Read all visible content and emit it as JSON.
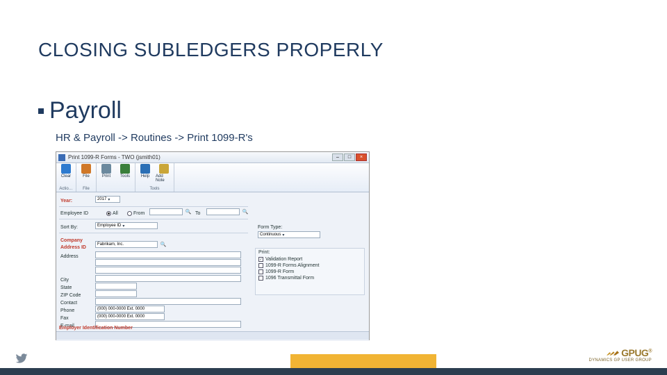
{
  "title": "CLOSING SUBLEDGERS PROPERLY",
  "section": "Payroll",
  "breadcrumb": "HR & Payroll -> Routines -> Print 1099-R's",
  "window": {
    "title": "Print 1099-R Forms - TWO (jsmith01)",
    "ribbon": {
      "groups": [
        {
          "foot": "Actio…",
          "items": [
            {
              "name": "clear-icon",
              "label": "Clear",
              "color": "#2e7bcf"
            }
          ]
        },
        {
          "foot": "File",
          "items": [
            {
              "name": "file-icon",
              "label": "File",
              "color": "#d07828"
            }
          ]
        },
        {
          "foot": "",
          "items": [
            {
              "name": "print-icon",
              "label": "Print",
              "color": "#6b899e"
            },
            {
              "name": "tools-icon",
              "label": "Tools",
              "color": "#3a7f3a"
            }
          ]
        },
        {
          "foot": "Tools",
          "items": [
            {
              "name": "help-icon",
              "label": "Help",
              "color": "#2b6fb5"
            },
            {
              "name": "addnote-icon",
              "label": "Add Note",
              "color": "#caa638"
            }
          ]
        }
      ]
    },
    "form": {
      "year_label": "Year:",
      "year_value": "2017",
      "employee_id_label": "Employee ID",
      "scope_all": "All",
      "scope_from": "From",
      "scope_to_label": "To",
      "sort_by_label": "Sort By:",
      "sort_by_value": "Employee ID",
      "form_type_label": "Form Type:",
      "form_type_value": "Continuous",
      "company_label": "Company",
      "address_id_label": "Address ID",
      "company_value": "Fabrikam, Inc.",
      "address_label": "Address",
      "city_label": "City",
      "state_label": "State",
      "zip_label": "ZIP Code",
      "contact_label": "Contact",
      "phone_label": "Phone",
      "phone_value": "(000) 000-0000 Ext. 0000",
      "fax_label": "Fax",
      "fax_value": "(000) 000-0000 Ext. 0000",
      "email_label": "E-mail",
      "print_label": "Print:",
      "print_opts": [
        {
          "label": "Validation Report",
          "checked": true
        },
        {
          "label": "1099-R Forms Alignment",
          "checked": false
        },
        {
          "label": "1099-R Form",
          "checked": false
        },
        {
          "label": "1096 Transmittal Form",
          "checked": false
        }
      ],
      "ein_label": "Employer Identification Number"
    }
  },
  "logo": {
    "brand": "GPUG",
    "sub": "Dynamics GP User Group"
  }
}
